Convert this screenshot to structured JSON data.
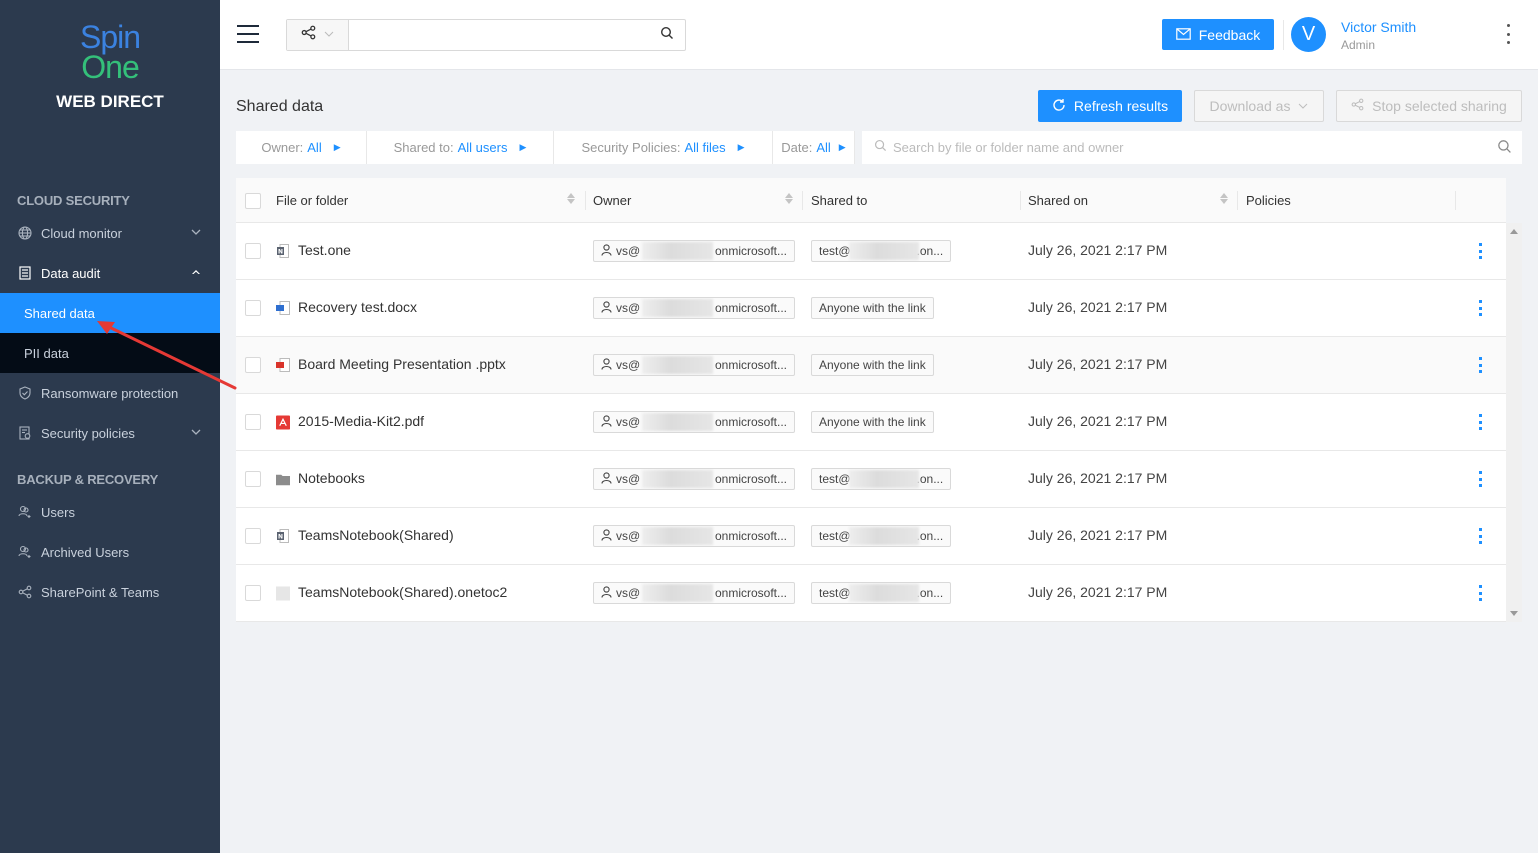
{
  "sidebar": {
    "logo": {
      "line1": "Spin",
      "line2": "One",
      "subtitle": "WEB DIRECT"
    },
    "sections": [
      {
        "title": "CLOUD SECURITY"
      },
      {
        "title": "BACKUP & RECOVERY"
      }
    ],
    "items": [
      {
        "label": "Cloud monitor",
        "icon": "globe-icon",
        "expandable": true,
        "expanded": false
      },
      {
        "label": "Data audit",
        "icon": "document-list-icon",
        "expandable": true,
        "expanded": true
      },
      {
        "label": "Shared data",
        "sub": true,
        "selected": true
      },
      {
        "label": "PII data",
        "sub": true
      },
      {
        "label": "Ransomware protection",
        "icon": "shield-icon"
      },
      {
        "label": "Security policies",
        "icon": "policy-icon",
        "expandable": true,
        "expanded": false
      },
      {
        "label": "Users",
        "icon": "users-icon"
      },
      {
        "label": "Archived Users",
        "icon": "users-icon"
      },
      {
        "label": "SharePoint & Teams",
        "icon": "share-icon"
      }
    ]
  },
  "header": {
    "search": {
      "type_icon": "share-icon",
      "value": "",
      "placeholder": ""
    },
    "feedback_label": "Feedback",
    "user": {
      "initial": "V",
      "name": "Victor Smith",
      "role": "Admin"
    }
  },
  "page": {
    "title": "Shared data",
    "actions": {
      "refresh": "Refresh results",
      "download": "Download as",
      "stop": "Stop selected sharing"
    },
    "filters": [
      {
        "label": "Owner:",
        "value": "All"
      },
      {
        "label": "Shared to:",
        "value": "All users"
      },
      {
        "label": "Security Policies:",
        "value": "All files"
      },
      {
        "label": "Date:",
        "value": "All"
      }
    ],
    "search_placeholder": "Search by file or folder name and owner"
  },
  "table": {
    "columns": [
      "File or folder",
      "Owner",
      "Shared to",
      "Shared on",
      "Policies"
    ],
    "rows": [
      {
        "name": "Test.one",
        "type": "onenote",
        "owner_prefix": "vs@",
        "owner_suffix": "onmicrosoft...",
        "shared_prefix": "test@",
        "shared_suffix": ".on...",
        "shared_blurred": true,
        "shared_on": "July 26, 2021 2:17 PM"
      },
      {
        "name": "Recovery test.docx",
        "type": "docx",
        "owner_prefix": "vs@",
        "owner_suffix": "onmicrosoft...",
        "shared_to": "Anyone with the link",
        "shared_blurred": false,
        "shared_on": "July 26, 2021 2:17 PM"
      },
      {
        "name": "Board Meeting Presentation .pptx",
        "type": "pptx",
        "owner_prefix": "vs@",
        "owner_suffix": "onmicrosoft...",
        "shared_to": "Anyone with the link",
        "shared_blurred": false,
        "shared_on": "July 26, 2021 2:17 PM"
      },
      {
        "name": "2015-Media-Kit2.pdf",
        "type": "pdf",
        "owner_prefix": "vs@",
        "owner_suffix": "onmicrosoft...",
        "shared_to": "Anyone with the link",
        "shared_blurred": false,
        "shared_on": "July 26, 2021 2:17 PM"
      },
      {
        "name": "Notebooks",
        "type": "folder",
        "owner_prefix": "vs@",
        "owner_suffix": "onmicrosoft...",
        "shared_prefix": "test@",
        "shared_suffix": ".on...",
        "shared_blurred": true,
        "shared_on": "July 26, 2021 2:17 PM"
      },
      {
        "name": "TeamsNotebook(Shared)",
        "type": "onenote",
        "owner_prefix": "vs@",
        "owner_suffix": "onmicrosoft...",
        "shared_prefix": "test@",
        "shared_suffix": ".on...",
        "shared_blurred": true,
        "shared_on": "July 26, 2021 2:17 PM"
      },
      {
        "name": "TeamsNotebook(Shared).onetoc2",
        "type": "generic",
        "owner_prefix": "vs@",
        "owner_suffix": "onmicrosoft...",
        "shared_prefix": "test@",
        "shared_suffix": ".on...",
        "shared_blurred": true,
        "shared_on": "July 26, 2021 2:17 PM"
      }
    ]
  },
  "colors": {
    "accent": "#1e90ff",
    "sidebar_bg": "#2c3a4e",
    "logo_blue": "#3b82e0",
    "logo_green": "#34c07a",
    "annotation_arrow": "#e53935"
  }
}
